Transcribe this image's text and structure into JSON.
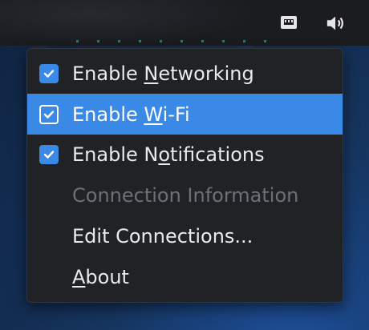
{
  "tray": {
    "network_icon": "network-wired-icon",
    "volume_icon": "volume-icon"
  },
  "menu": {
    "items": [
      {
        "label_pre": "Enable ",
        "label_mnemonic": "N",
        "label_post": "etworking",
        "checked": true,
        "state": "normal"
      },
      {
        "label_pre": "Enable ",
        "label_mnemonic": "W",
        "label_post": "i-Fi",
        "checked": true,
        "state": "highlighted"
      },
      {
        "label_pre": "Enable N",
        "label_mnemonic": "o",
        "label_post": "tifications",
        "checked": true,
        "state": "normal"
      },
      {
        "label": "Connection Information",
        "state": "disabled"
      },
      {
        "label": "Edit Connections...",
        "state": "normal"
      },
      {
        "label_pre": "",
        "label_mnemonic": "A",
        "label_post": "bout",
        "state": "normal"
      }
    ]
  },
  "colors": {
    "accent": "#3a89e6",
    "menu_bg": "#202226",
    "panel_bg": "#1b1c20",
    "text": "#e9eaec",
    "disabled_text": "#6e7075"
  }
}
